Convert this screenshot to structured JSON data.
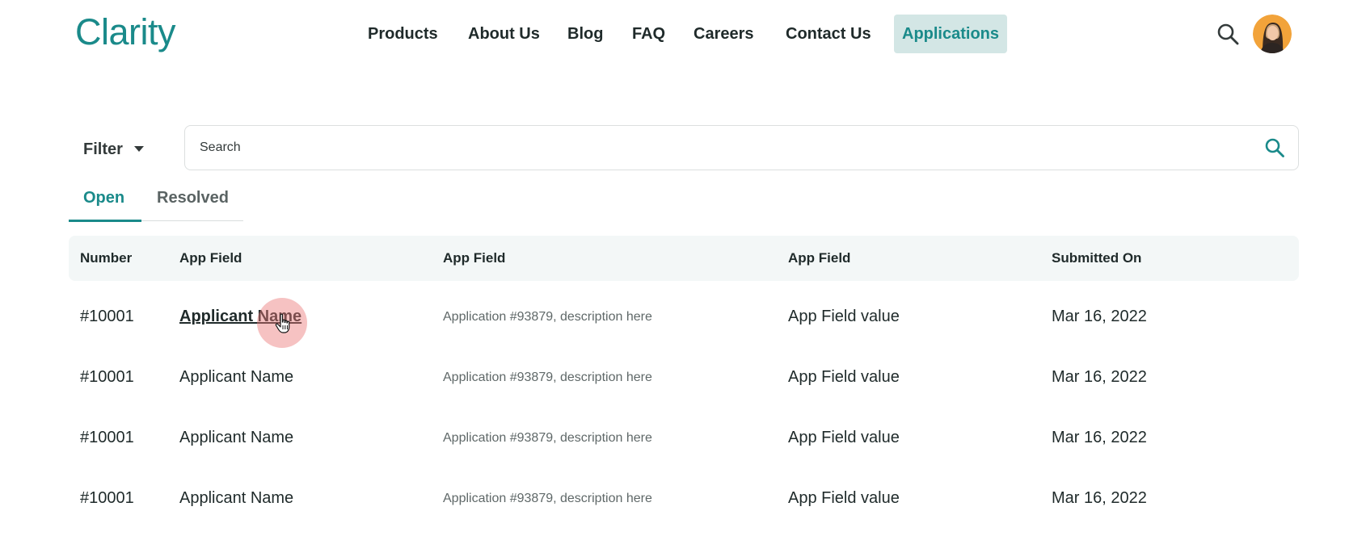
{
  "brand": {
    "logo": "Clarity",
    "accent": "#1a8a8a"
  },
  "nav": {
    "items": [
      {
        "label": "Products",
        "active": false
      },
      {
        "label": "About Us",
        "active": false
      },
      {
        "label": "Blog",
        "active": false
      },
      {
        "label": "FAQ",
        "active": false
      },
      {
        "label": "Careers",
        "active": false
      },
      {
        "label": "Contact Us",
        "active": false
      },
      {
        "label": "Applications",
        "active": true
      }
    ],
    "search_icon": "search-icon",
    "avatar": "user-avatar"
  },
  "toolbar": {
    "filter_label": "Filter",
    "filter_icon": "caret-down-icon",
    "search_placeholder": "Search",
    "search_value": "",
    "search_icon": "search-icon"
  },
  "tabs": [
    {
      "label": "Open",
      "active": true
    },
    {
      "label": "Resolved",
      "active": false
    }
  ],
  "table": {
    "columns": [
      "Number",
      "App Field",
      "App Field",
      "App Field",
      "Submitted On"
    ],
    "rows": [
      {
        "number": "#10001",
        "name": "Applicant Name",
        "description": "Application #93879, description here",
        "value": "App Field value",
        "date": "Mar 16, 2022",
        "hovered": true
      },
      {
        "number": "#10001",
        "name": "Applicant Name",
        "description": "Application #93879, description here",
        "value": "App Field value",
        "date": "Mar 16, 2022",
        "hovered": false
      },
      {
        "number": "#10001",
        "name": "Applicant Name",
        "description": "Application #93879, description here",
        "value": "App Field value",
        "date": "Mar 16, 2022",
        "hovered": false
      },
      {
        "number": "#10001",
        "name": "Applicant Name",
        "description": "Application #93879, description here",
        "value": "App Field value",
        "date": "Mar 16, 2022",
        "hovered": false
      }
    ]
  }
}
